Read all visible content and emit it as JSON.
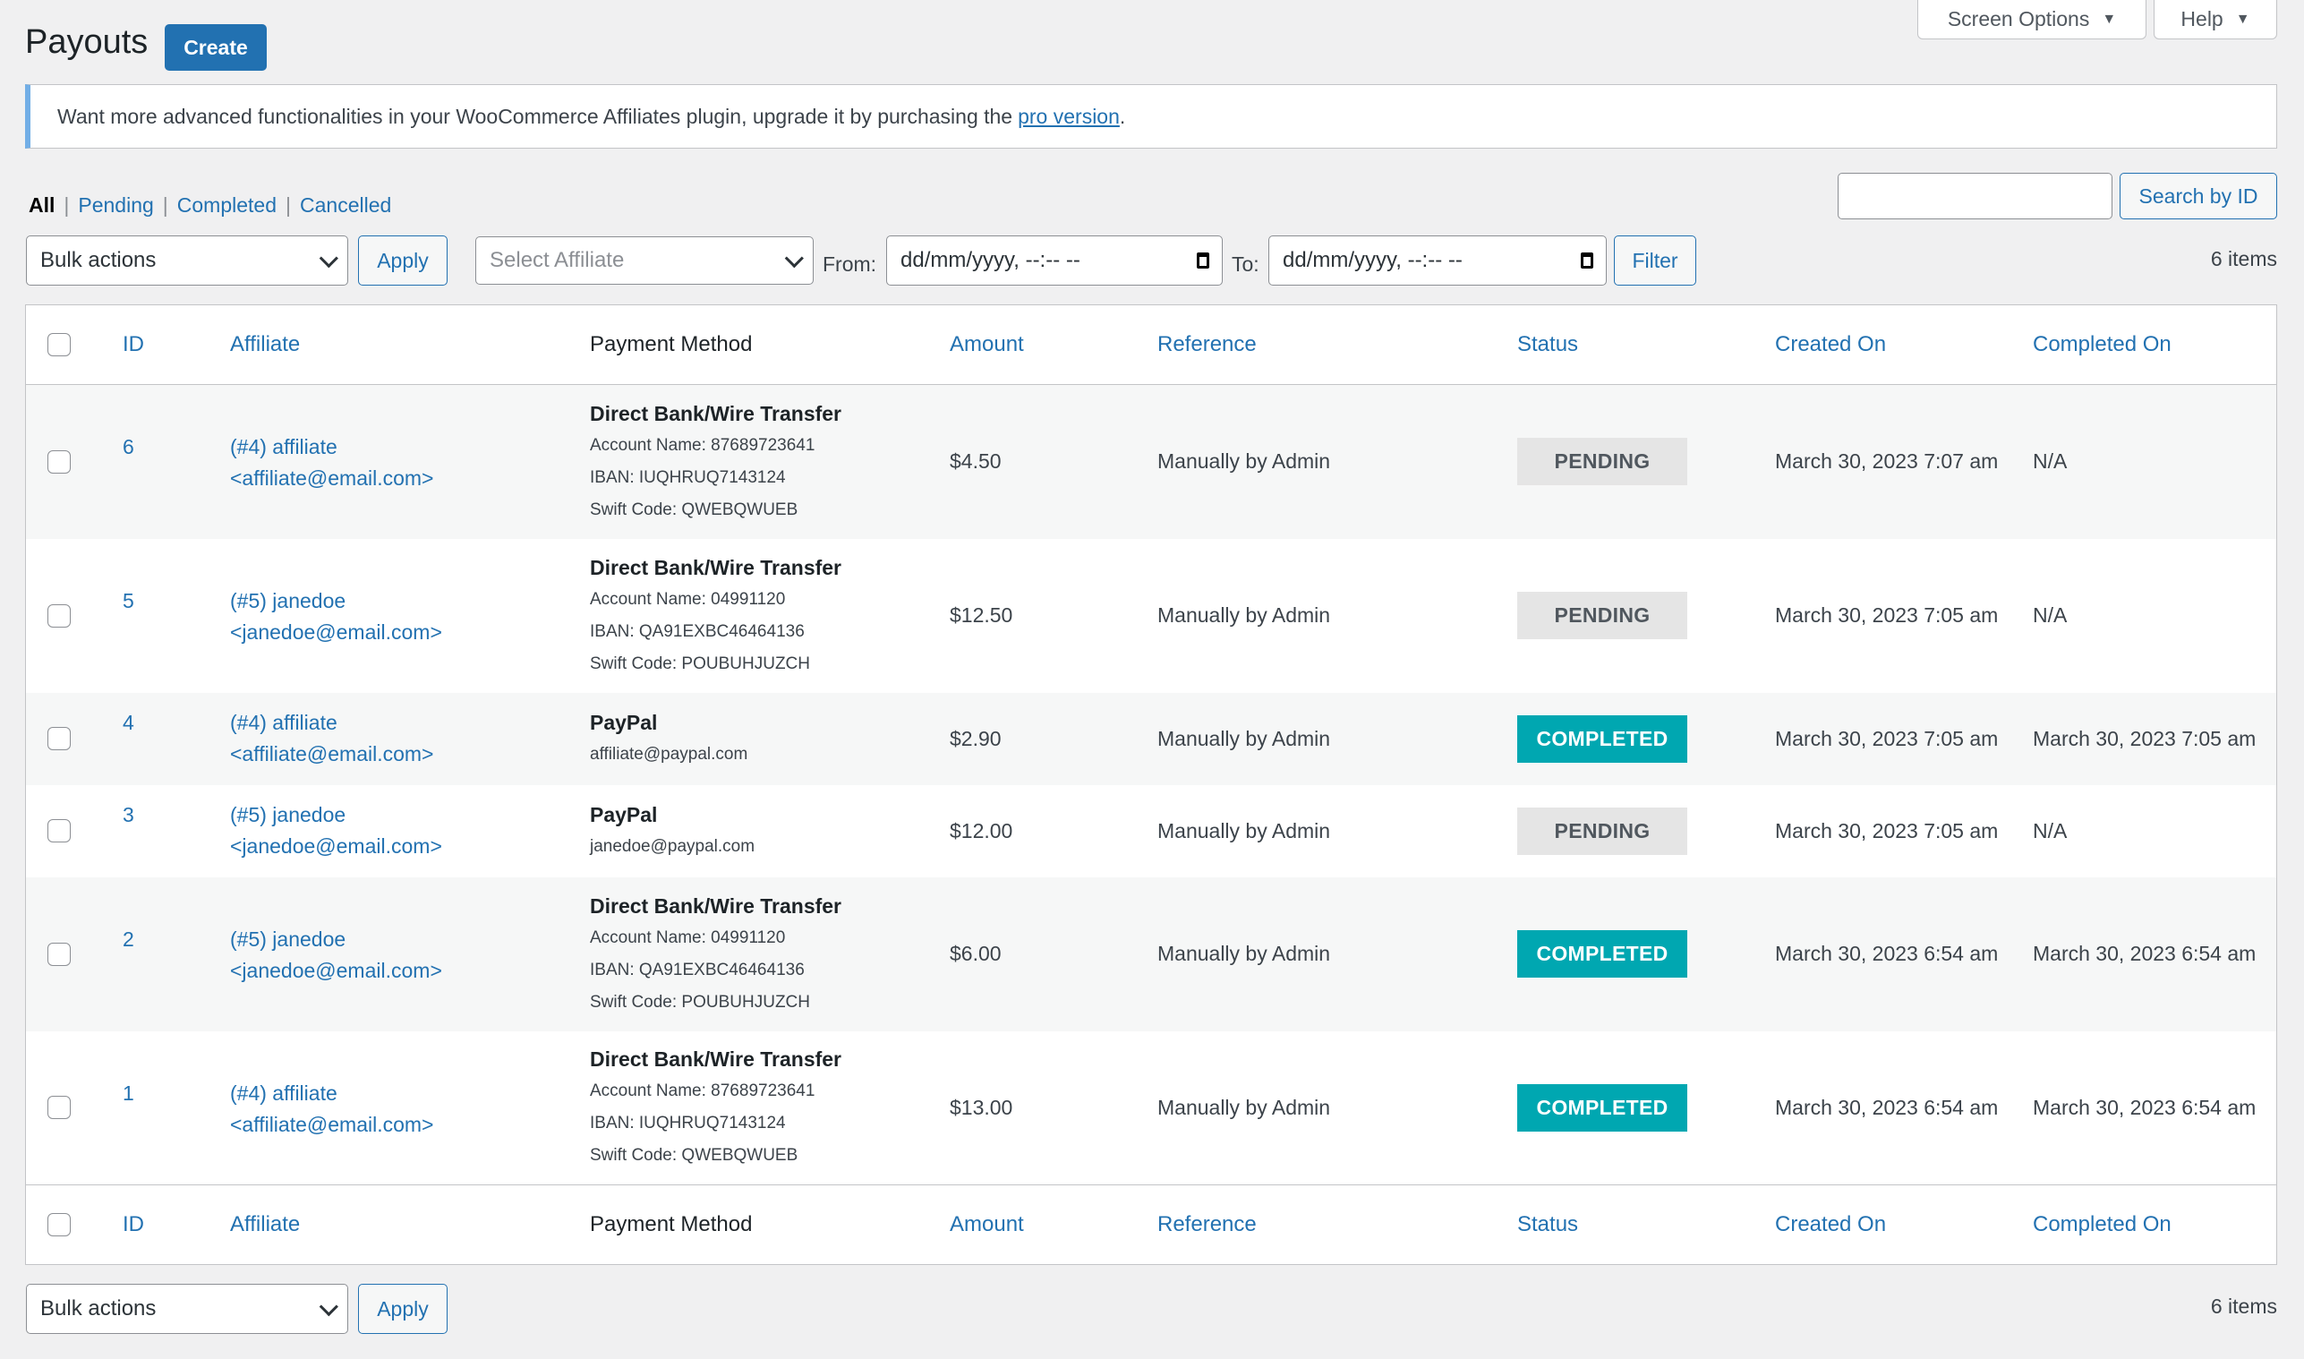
{
  "screen_meta": {
    "screen_options_label": "Screen Options",
    "help_label": "Help",
    "caret": "▼"
  },
  "header": {
    "title": "Payouts",
    "create_label": "Create"
  },
  "notice": {
    "text": "Want more advanced functionalities in your WooCommerce Affiliates plugin, upgrade it by purchasing the",
    "link_text": "pro version",
    "suffix": "."
  },
  "views": {
    "items": [
      {
        "label": "All",
        "current": true
      },
      {
        "label": "Pending",
        "current": false
      },
      {
        "label": "Completed",
        "current": false
      },
      {
        "label": "Cancelled",
        "current": false
      }
    ],
    "separator": "|"
  },
  "search": {
    "value": "",
    "button_label": "Search by ID"
  },
  "filters": {
    "bulk_actions": "Bulk actions",
    "apply_label": "Apply",
    "affiliate_placeholder": "Select Affiliate",
    "from_label": "From:",
    "from_value": "dd/mm/yyyy, --:-- --",
    "to_label": "To:",
    "to_value": "dd/mm/yyyy, --:-- --",
    "filter_label": "Filter",
    "items_count": "6 items"
  },
  "table": {
    "columns": [
      "ID",
      "Affiliate",
      "Payment Method",
      "Amount",
      "Reference",
      "Status",
      "Created On",
      "Completed On"
    ],
    "rows": [
      {
        "id": "6",
        "affiliate_name": "(#4) affiliate",
        "affiliate_email": "<affiliate@email.com>",
        "payment_method": "Direct Bank/Wire Transfer",
        "payment_details": [
          "Account Name: 87689723641",
          "IBAN: IUQHRUQ7143124",
          "Swift Code: QWEBQWUEB"
        ],
        "amount": "$4.50",
        "reference": "Manually by Admin",
        "status": "PENDING",
        "status_type": "pending",
        "created_on": "March 30, 2023 7:07 am",
        "completed_on": "N/A"
      },
      {
        "id": "5",
        "affiliate_name": "(#5) janedoe",
        "affiliate_email": "<janedoe@email.com>",
        "payment_method": "Direct Bank/Wire Transfer",
        "payment_details": [
          "Account Name: 04991120",
          "IBAN: QA91EXBC46464136",
          "Swift Code: POUBUHJUZCH"
        ],
        "amount": "$12.50",
        "reference": "Manually by Admin",
        "status": "PENDING",
        "status_type": "pending",
        "created_on": "March 30, 2023 7:05 am",
        "completed_on": "N/A"
      },
      {
        "id": "4",
        "affiliate_name": "(#4) affiliate",
        "affiliate_email": "<affiliate@email.com>",
        "payment_method": "PayPal",
        "payment_details": [
          "affiliate@paypal.com"
        ],
        "amount": "$2.90",
        "reference": "Manually by Admin",
        "status": "COMPLETED",
        "status_type": "completed",
        "created_on": "March 30, 2023 7:05 am",
        "completed_on": "March 30, 2023 7:05 am"
      },
      {
        "id": "3",
        "affiliate_name": "(#5) janedoe",
        "affiliate_email": "<janedoe@email.com>",
        "payment_method": "PayPal",
        "payment_details": [
          "janedoe@paypal.com"
        ],
        "amount": "$12.00",
        "reference": "Manually by Admin",
        "status": "PENDING",
        "status_type": "pending",
        "created_on": "March 30, 2023 7:05 am",
        "completed_on": "N/A"
      },
      {
        "id": "2",
        "affiliate_name": "(#5) janedoe",
        "affiliate_email": "<janedoe@email.com>",
        "payment_method": "Direct Bank/Wire Transfer",
        "payment_details": [
          "Account Name: 04991120",
          "IBAN: QA91EXBC46464136",
          "Swift Code: POUBUHJUZCH"
        ],
        "amount": "$6.00",
        "reference": "Manually by Admin",
        "status": "COMPLETED",
        "status_type": "completed",
        "created_on": "March 30, 2023 6:54 am",
        "completed_on": "March 30, 2023 6:54 am"
      },
      {
        "id": "1",
        "affiliate_name": "(#4) affiliate",
        "affiliate_email": "<affiliate@email.com>",
        "payment_method": "Direct Bank/Wire Transfer",
        "payment_details": [
          "Account Name: 87689723641",
          "IBAN: IUQHRUQ7143124",
          "Swift Code: QWEBQWUEB"
        ],
        "amount": "$13.00",
        "reference": "Manually by Admin",
        "status": "COMPLETED",
        "status_type": "completed",
        "created_on": "March 30, 2023 6:54 am",
        "completed_on": "March 30, 2023 6:54 am"
      }
    ]
  },
  "footer": {
    "bulk_actions": "Bulk actions",
    "apply_label": "Apply",
    "items_count": "6 items"
  },
  "colors": {
    "accent": "#2271b1",
    "completed_badge": "#00a7b1",
    "pending_badge": "#e5e5e5",
    "notice_border": "#72aee6"
  }
}
